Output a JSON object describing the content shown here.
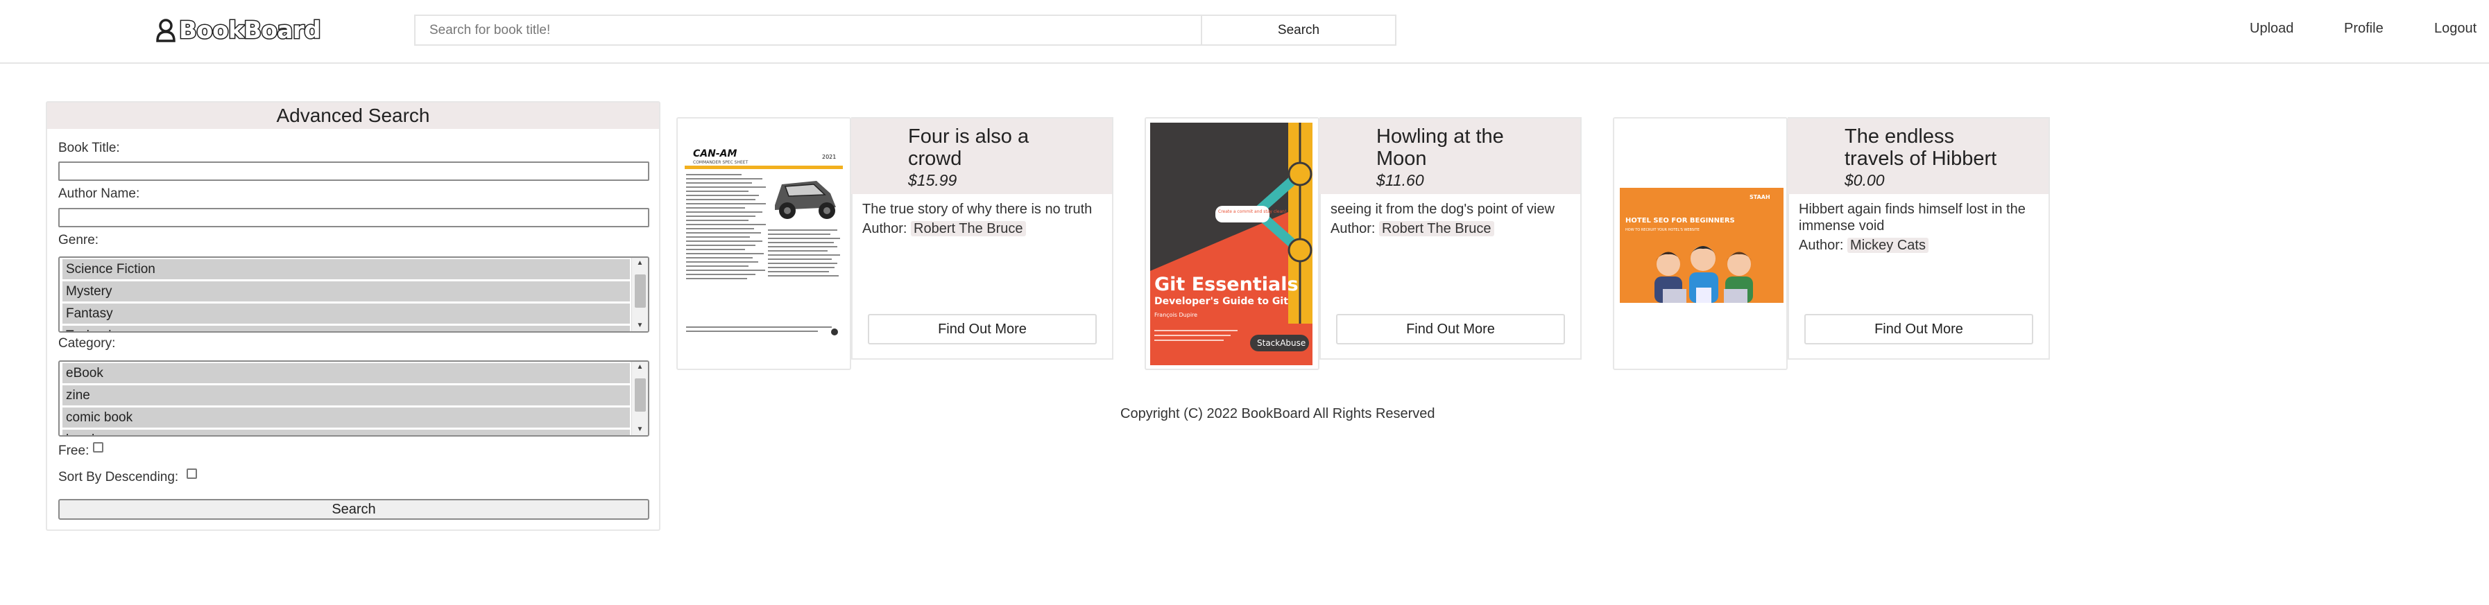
{
  "header": {
    "logo_text": "BookBoard",
    "search_placeholder": "Search for book title!",
    "search_button": "Search",
    "nav": [
      "Upload",
      "Profile",
      "Logout"
    ]
  },
  "advanced_search": {
    "title": "Advanced Search",
    "book_title_label": "Book Title:",
    "author_label": "Author Name:",
    "genre_label": "Genre:",
    "genre_options": [
      "Science Fiction",
      "Mystery",
      "Fantasy",
      "Technology"
    ],
    "category_label": "Category:",
    "category_options": [
      "eBook",
      "zine",
      "comic book",
      "brochure"
    ],
    "free_label": "Free:",
    "sort_label": "Sort By Descending:",
    "search_button": "Search"
  },
  "books": [
    {
      "title": "Four is also a crowd",
      "price": "$15.99",
      "description": "The true story of why there is no truth",
      "author_prefix": "Author:",
      "author": "Robert The Bruce",
      "button": "Find Out More",
      "cover": {
        "brand": "CAN-AM",
        "subtitle": "COMMANDER SPEC SHEET",
        "year": "2021"
      }
    },
    {
      "title": "Howling at the Moon",
      "price": "$11.60",
      "description": "seeing it from the dog's point of view",
      "author_prefix": "Author:",
      "author": "Robert The Bruce",
      "button": "Find Out More",
      "cover": {
        "title": "Git Essentials",
        "subtitle": "Developer's Guide to Git",
        "author": "François Dupire",
        "badge": "StackAbuse",
        "bubble": "Create a commit and stay clean!"
      }
    },
    {
      "title": "The endless travels of Hibbert",
      "price": "$0.00",
      "description": "Hibbert again finds himself lost in the immense void",
      "author_prefix": "Author:",
      "author": "Mickey Cats",
      "button": "Find Out More",
      "cover": {
        "title": "HOTEL SEO FOR BEGINNERS",
        "subtitle": "HOW TO RECRUIT YOUR HOTEL'S WEBSITE",
        "brand": "STAAH"
      }
    }
  ],
  "footer": "Copyright (C) 2022 BookBoard All Rights Reserved"
}
